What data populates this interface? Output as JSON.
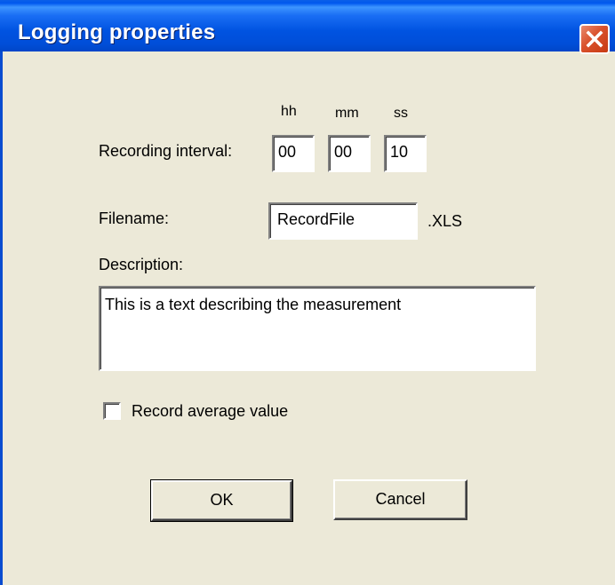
{
  "window": {
    "title": "Logging properties"
  },
  "interval": {
    "label": "Recording interval:",
    "units": {
      "hours": "hh",
      "minutes": "mm",
      "seconds": "ss"
    },
    "values": {
      "hours": "00",
      "minutes": "00",
      "seconds": "10"
    }
  },
  "filename": {
    "label": "Filename:",
    "value": "RecordFile",
    "extension": ".XLS"
  },
  "description": {
    "label": "Description:",
    "value": "This is a text describing the measurement"
  },
  "record_average": {
    "label": "Record average value",
    "checked": false
  },
  "buttons": {
    "ok": "OK",
    "cancel": "Cancel"
  },
  "colors": {
    "titlebar": "#0058EE",
    "dialog_bg": "#ECE9D8",
    "close_button": "#D9512C"
  },
  "icons": {
    "close": "close-icon"
  }
}
